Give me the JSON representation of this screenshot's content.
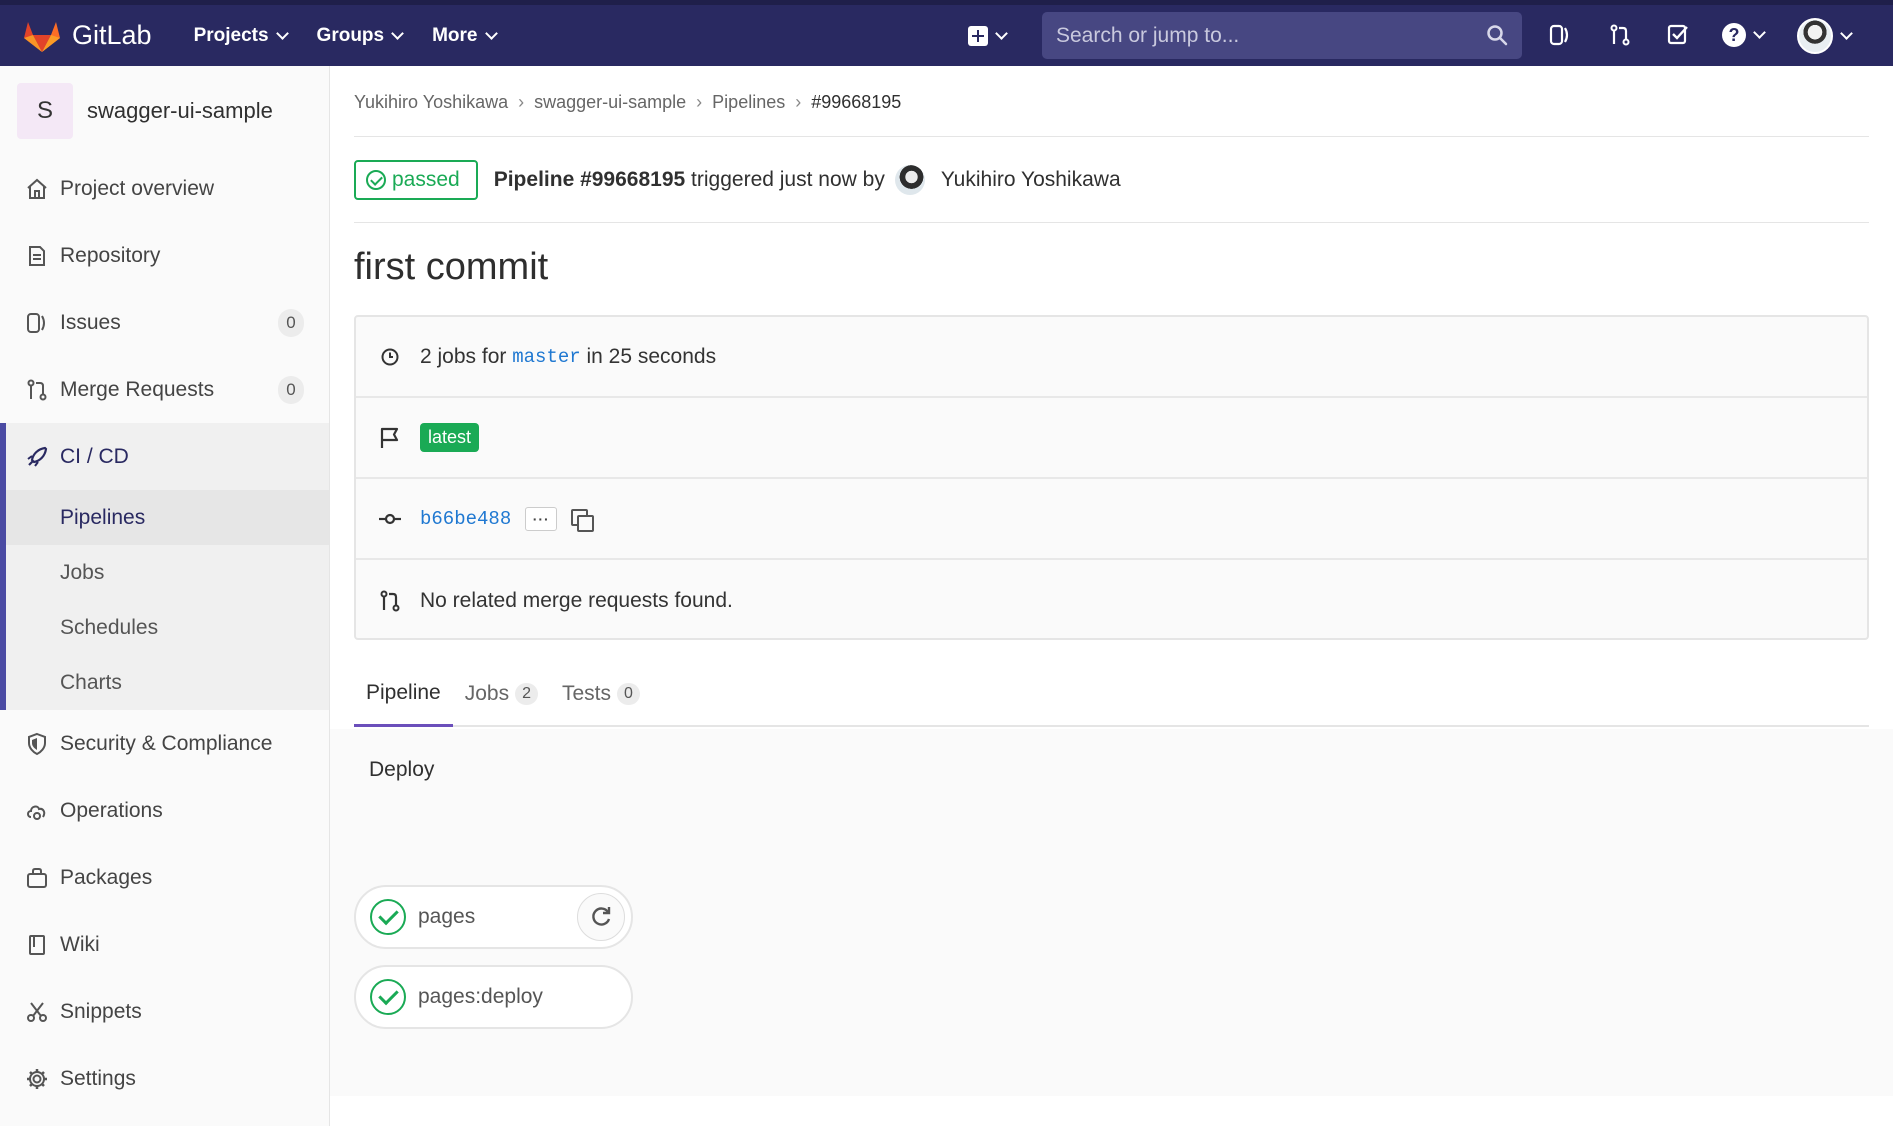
{
  "brand": {
    "name": "GitLab"
  },
  "topnav": {
    "menu": [
      {
        "label": "Projects"
      },
      {
        "label": "Groups"
      },
      {
        "label": "More"
      }
    ],
    "search_placeholder": "Search or jump to...",
    "help_glyph": "?"
  },
  "sidebar": {
    "project_initial": "S",
    "project_name": "swagger-ui-sample",
    "items": [
      {
        "label": "Project overview",
        "icon": "home-icon"
      },
      {
        "label": "Repository",
        "icon": "doc-icon"
      },
      {
        "label": "Issues",
        "icon": "issues-icon",
        "count": "0"
      },
      {
        "label": "Merge Requests",
        "icon": "merge-request-icon",
        "count": "0"
      }
    ],
    "cicd": {
      "label": "CI / CD",
      "sub": [
        "Pipelines",
        "Jobs",
        "Schedules",
        "Charts"
      ]
    },
    "items_after": [
      {
        "label": "Security & Compliance",
        "icon": "shield-icon"
      },
      {
        "label": "Operations",
        "icon": "cloud-icon"
      },
      {
        "label": "Packages",
        "icon": "package-icon"
      },
      {
        "label": "Wiki",
        "icon": "book-icon"
      },
      {
        "label": "Snippets",
        "icon": "scissors-icon"
      },
      {
        "label": "Settings",
        "icon": "gear-icon"
      }
    ]
  },
  "breadcrumb": [
    "Yukihiro Yoshikawa",
    "swagger-ui-sample",
    "Pipelines",
    "#99668195"
  ],
  "pipeline": {
    "status": "passed",
    "title": "Pipeline #99668195",
    "triggered": "triggered just now by",
    "user": "Yukihiro Yoshikawa",
    "commit_title": "first commit",
    "jobs_prefix": "2 jobs for",
    "branch": "master",
    "jobs_suffix": "in 25 seconds",
    "badge": "latest",
    "sha": "b66be488",
    "ellipsis": "···",
    "merge_requests": "No related merge requests found."
  },
  "tabs": [
    {
      "label": "Pipeline"
    },
    {
      "label": "Jobs",
      "count": "2"
    },
    {
      "label": "Tests",
      "count": "0"
    }
  ],
  "stage": {
    "name": "Deploy",
    "jobs": [
      "pages",
      "pages:deploy"
    ]
  },
  "colors": {
    "nav": "#292961",
    "success": "#1aaa55",
    "link": "#1f78d1",
    "active_tab": "#6b4fbb"
  }
}
